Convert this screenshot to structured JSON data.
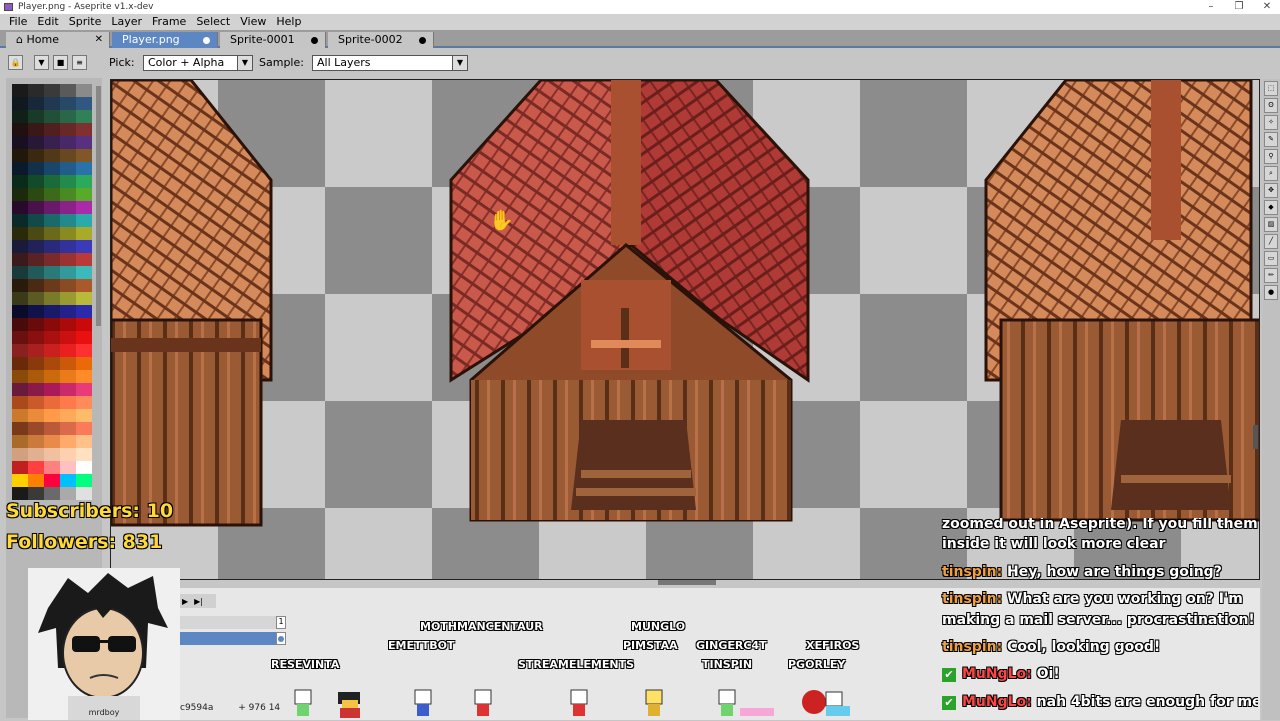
{
  "window": {
    "title": "Player.png - Aseprite v1.x-dev"
  },
  "menu": [
    "File",
    "Edit",
    "Sprite",
    "Layer",
    "Frame",
    "Select",
    "View",
    "Help"
  ],
  "tabs": [
    {
      "label": "Home",
      "closable": true
    },
    {
      "label": "Player.png",
      "active": true
    },
    {
      "label": "Sprite-0001"
    },
    {
      "label": "Sprite-0002"
    }
  ],
  "toolbar": {
    "pick_label": "Pick:",
    "pick_value": "Color + Alpha",
    "sample_label": "Sample:",
    "sample_value": "All Layers"
  },
  "stream": {
    "subscribers": "Subscribers: 10",
    "followers": "Followers: 831",
    "webcam_name": "mrdboy"
  },
  "chat": [
    {
      "user": "",
      "text": "zoomed out in Aseprite). If you fill them"
    },
    {
      "user": "",
      "text": "inside it will look more clear"
    },
    {
      "user": "tinspin:",
      "text": " Hey, how are things going?",
      "style": "u1"
    },
    {
      "user": "tinspin:",
      "text": " What are you working on? I'm",
      "style": "u1"
    },
    {
      "user": "",
      "text": "making a mail server... procrastination!"
    },
    {
      "user": "tinspin:",
      "text": " Cool, looking good!",
      "style": "u1"
    },
    {
      "user": "MuNgLo:",
      "text": " Oi!",
      "style": "u2",
      "check": true
    },
    {
      "user": "MuNgLo:",
      "text": " nah 4bits are enough for me",
      "style": "u2",
      "check": true
    }
  ],
  "viewers": [
    "MOTHMANCENTAUR",
    "MUNGLO",
    "EMETTBOT",
    "PIMSTAA",
    "GINGERC4T",
    "XEFIROS",
    "RESEVINTA",
    "STREAMELEMENTS",
    "TINSPIN",
    "PGORLEY"
  ],
  "status": {
    "color_text": "c9594a",
    "coords": "976 14"
  },
  "colors": {
    "accent": "#5d87c2",
    "roof_red": "#c9594a",
    "roof_brown": "#b8643c",
    "wood": "#8a4a2a"
  }
}
